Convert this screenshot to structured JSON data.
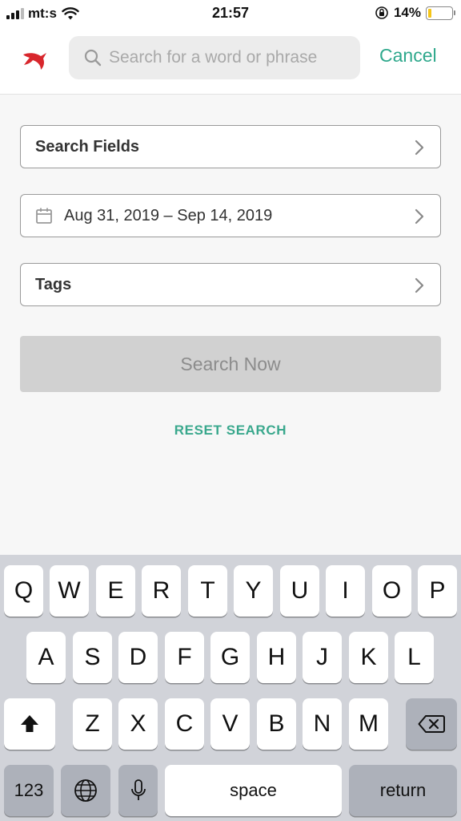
{
  "status_bar": {
    "carrier": "mt:s",
    "time": "21:57",
    "battery": "14%",
    "battery_level": 0.14
  },
  "header": {
    "logo_icon": "bird-logo-icon",
    "search_placeholder": "Search for a word or phrase",
    "search_value": "",
    "cancel_label": "Cancel"
  },
  "filters": {
    "search_fields_label": "Search Fields",
    "date_range": "Aug 31, 2019 – Sep 14, 2019",
    "tags_label": "Tags"
  },
  "actions": {
    "search_now_label": "Search Now",
    "reset_label": "RESET SEARCH"
  },
  "keyboard": {
    "row1": [
      "Q",
      "W",
      "E",
      "R",
      "T",
      "Y",
      "U",
      "I",
      "O",
      "P"
    ],
    "row2": [
      "A",
      "S",
      "D",
      "F",
      "G",
      "H",
      "J",
      "K",
      "L"
    ],
    "row3": [
      "Z",
      "X",
      "C",
      "V",
      "B",
      "N",
      "M"
    ],
    "numbers_label": "123",
    "space_label": "space",
    "return_label": "return"
  },
  "colors": {
    "accent": "#2ea88c",
    "logo": "#d8262c",
    "disabled_button": "#d1d1d1",
    "keyboard_bg": "#d1d3d9"
  }
}
